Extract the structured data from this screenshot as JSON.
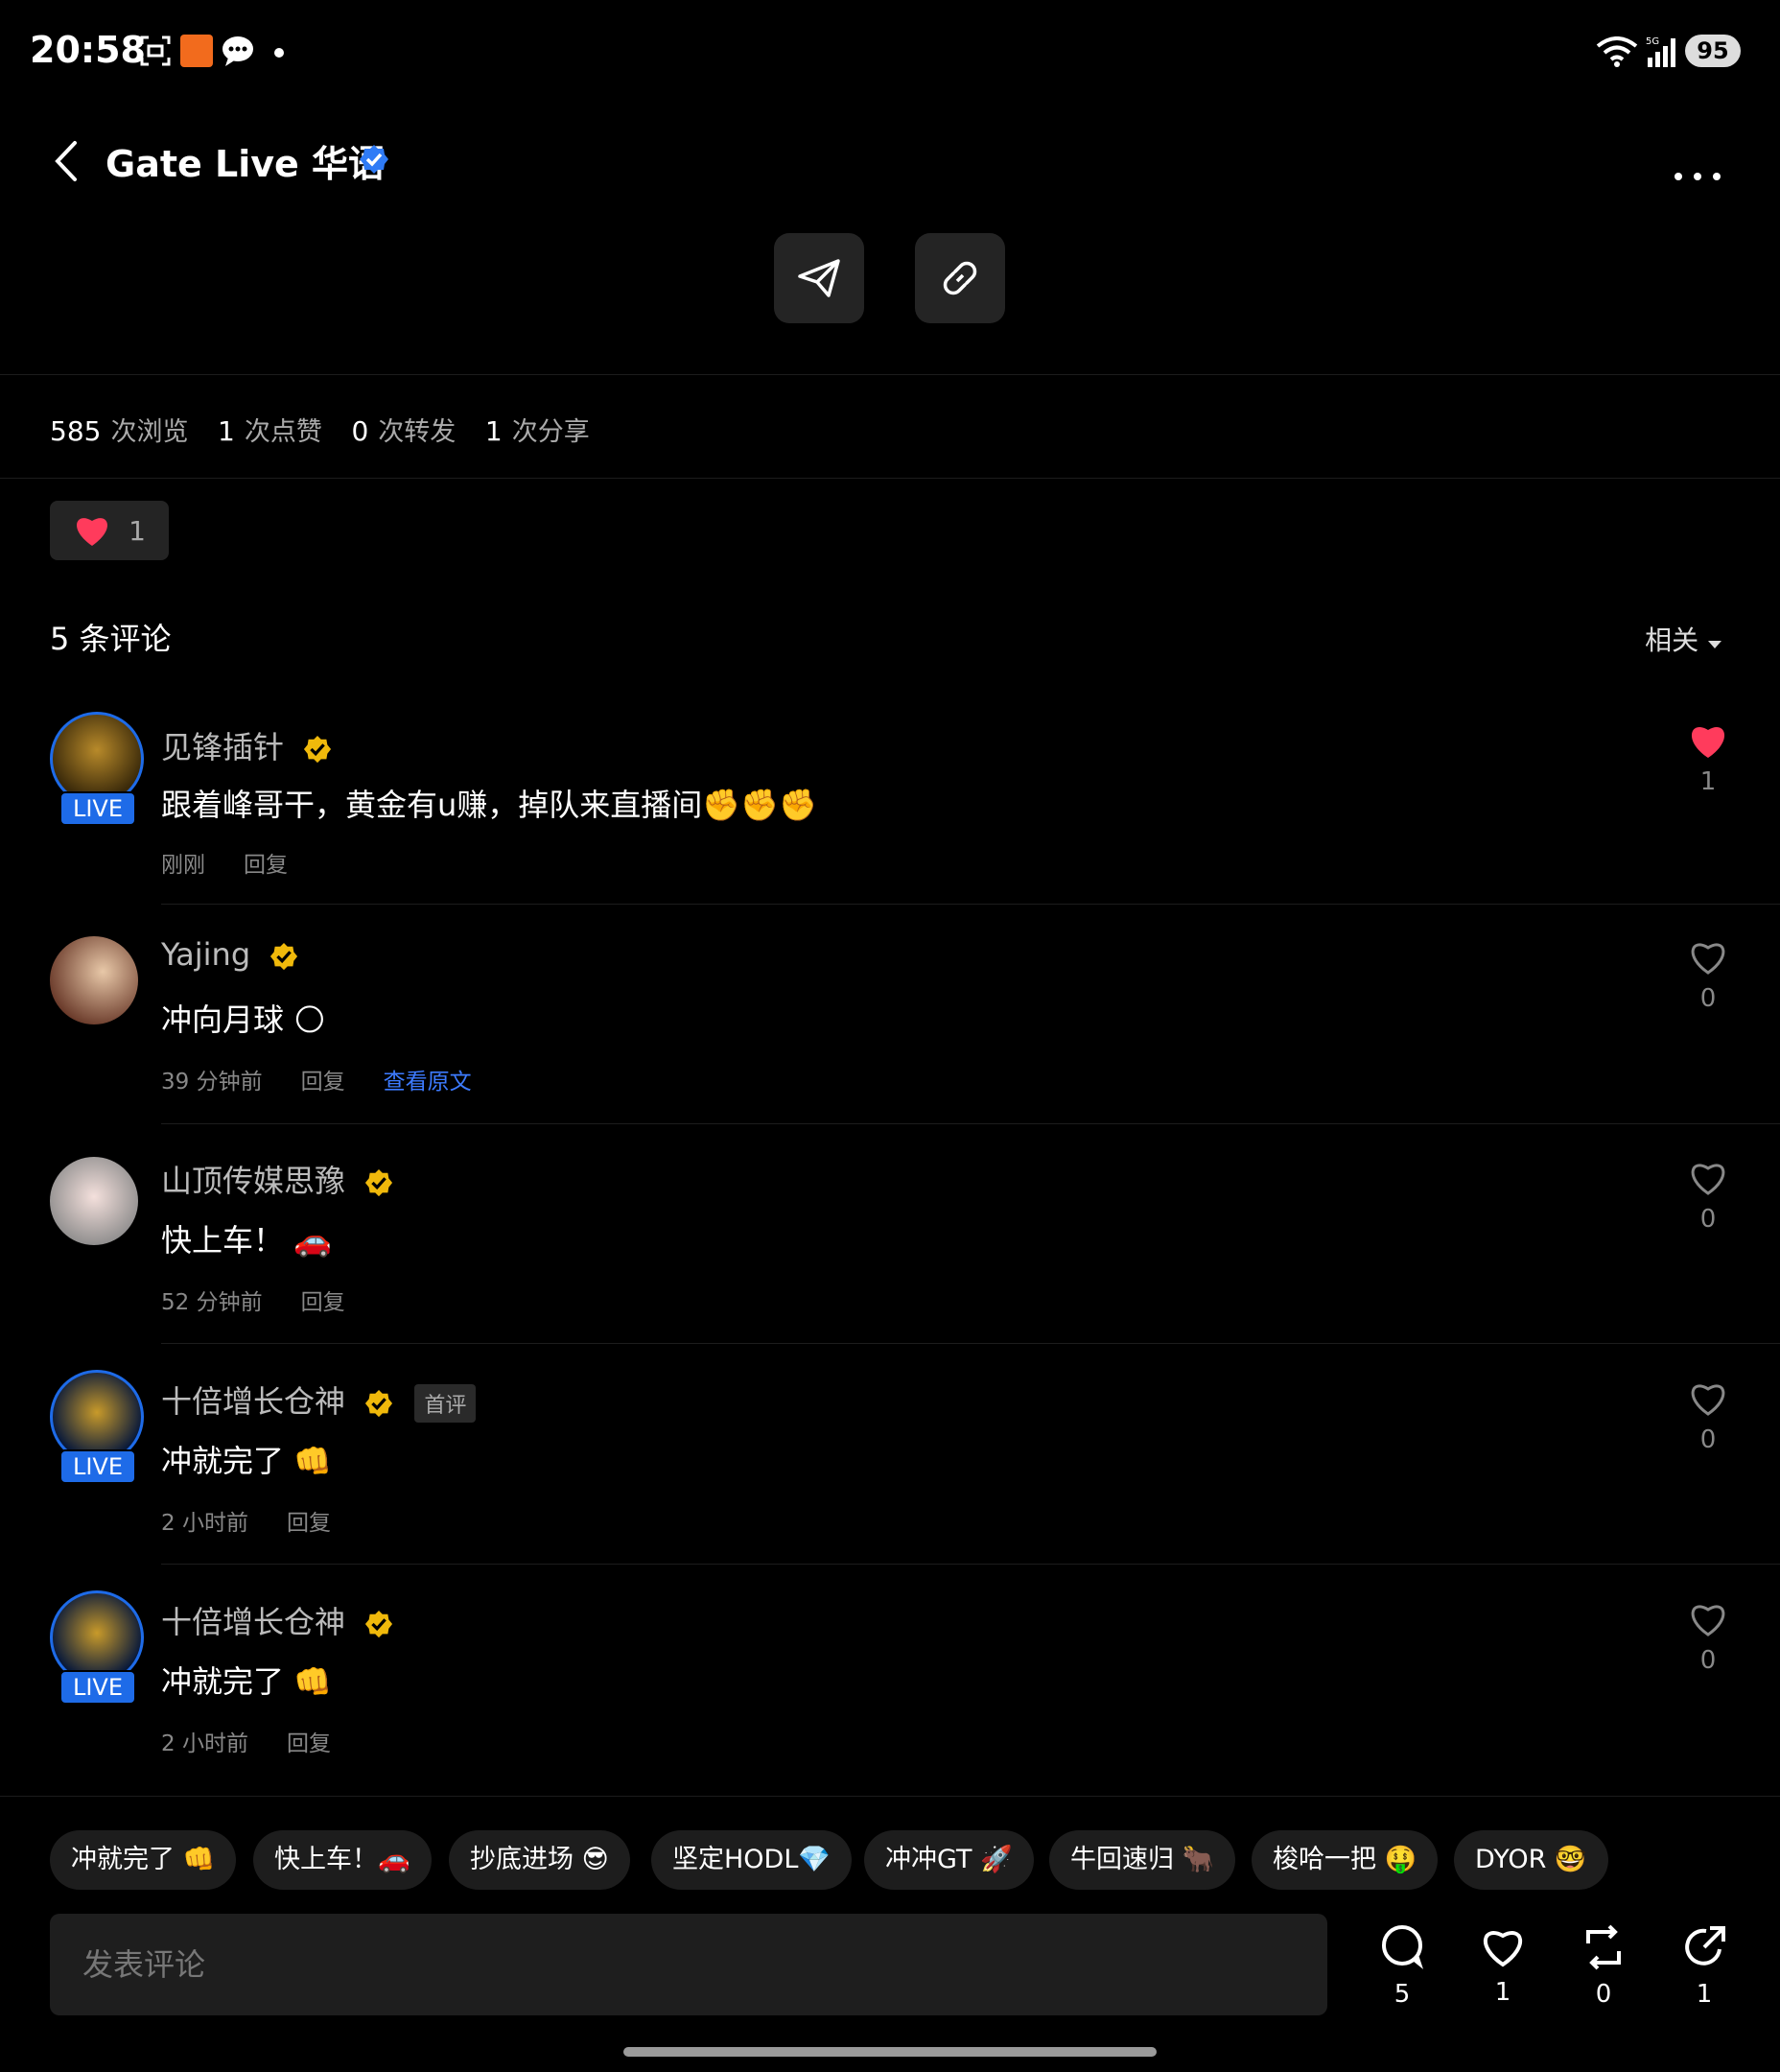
{
  "status_bar": {
    "time": "20:58",
    "battery": "95",
    "network": "5G"
  },
  "header": {
    "title": "Gate Live 华语",
    "more_icon": "more-icon"
  },
  "stats": [
    {
      "value": "585",
      "label": "次浏览"
    },
    {
      "value": "1",
      "label": "次点赞"
    },
    {
      "value": "0",
      "label": "次转发"
    },
    {
      "value": "1",
      "label": "次分享"
    }
  ],
  "reaction": {
    "count": "1"
  },
  "comments_header": {
    "title": "5 条评论",
    "sort": "相关"
  },
  "comments": [
    {
      "name": "见锋插针",
      "text": "跟着峰哥干，黄金有u赚，掉队来直播间",
      "emoji": "✊✊✊",
      "time": "刚刚",
      "reply": "回复",
      "likes": "1",
      "liked": true,
      "live": "LIVE"
    },
    {
      "name": "Yajing",
      "text": "冲向月球",
      "emoji": "🌕",
      "time": "39 分钟前",
      "reply": "回复",
      "view_original": "查看原文",
      "likes": "0",
      "liked": false
    },
    {
      "name": "山顶传媒思豫",
      "text": "快上车！",
      "emoji": "🚗",
      "time": "52 分钟前",
      "reply": "回复",
      "likes": "0",
      "liked": false
    },
    {
      "name": "十倍增长仓神",
      "badge": "首评",
      "text": "冲就完了",
      "emoji": "👊",
      "time": "2 小时前",
      "reply": "回复",
      "likes": "0",
      "liked": false,
      "live": "LIVE"
    },
    {
      "name": "十倍增长仓神",
      "text": "冲就完了",
      "emoji": "👊",
      "time": "2 小时前",
      "reply": "回复",
      "likes": "0",
      "liked": false,
      "live": "LIVE"
    }
  ],
  "quick_tags": [
    "冲就完了 👊",
    "快上车！🚗",
    "抄底进场 😎",
    "坚定HODL💎",
    "冲冲GT 🚀",
    "牛回速归 🐂",
    "梭哈一把 🤑",
    "DYOR 🤓"
  ],
  "input": {
    "placeholder": "发表评论"
  },
  "actions": {
    "comments": "5",
    "likes": "1",
    "reposts": "0",
    "shares": "1"
  },
  "colors": {
    "accent": "#1e6be8",
    "like": "#ff3b5c",
    "verified": "#f0b90b",
    "link": "#3d7bff"
  }
}
